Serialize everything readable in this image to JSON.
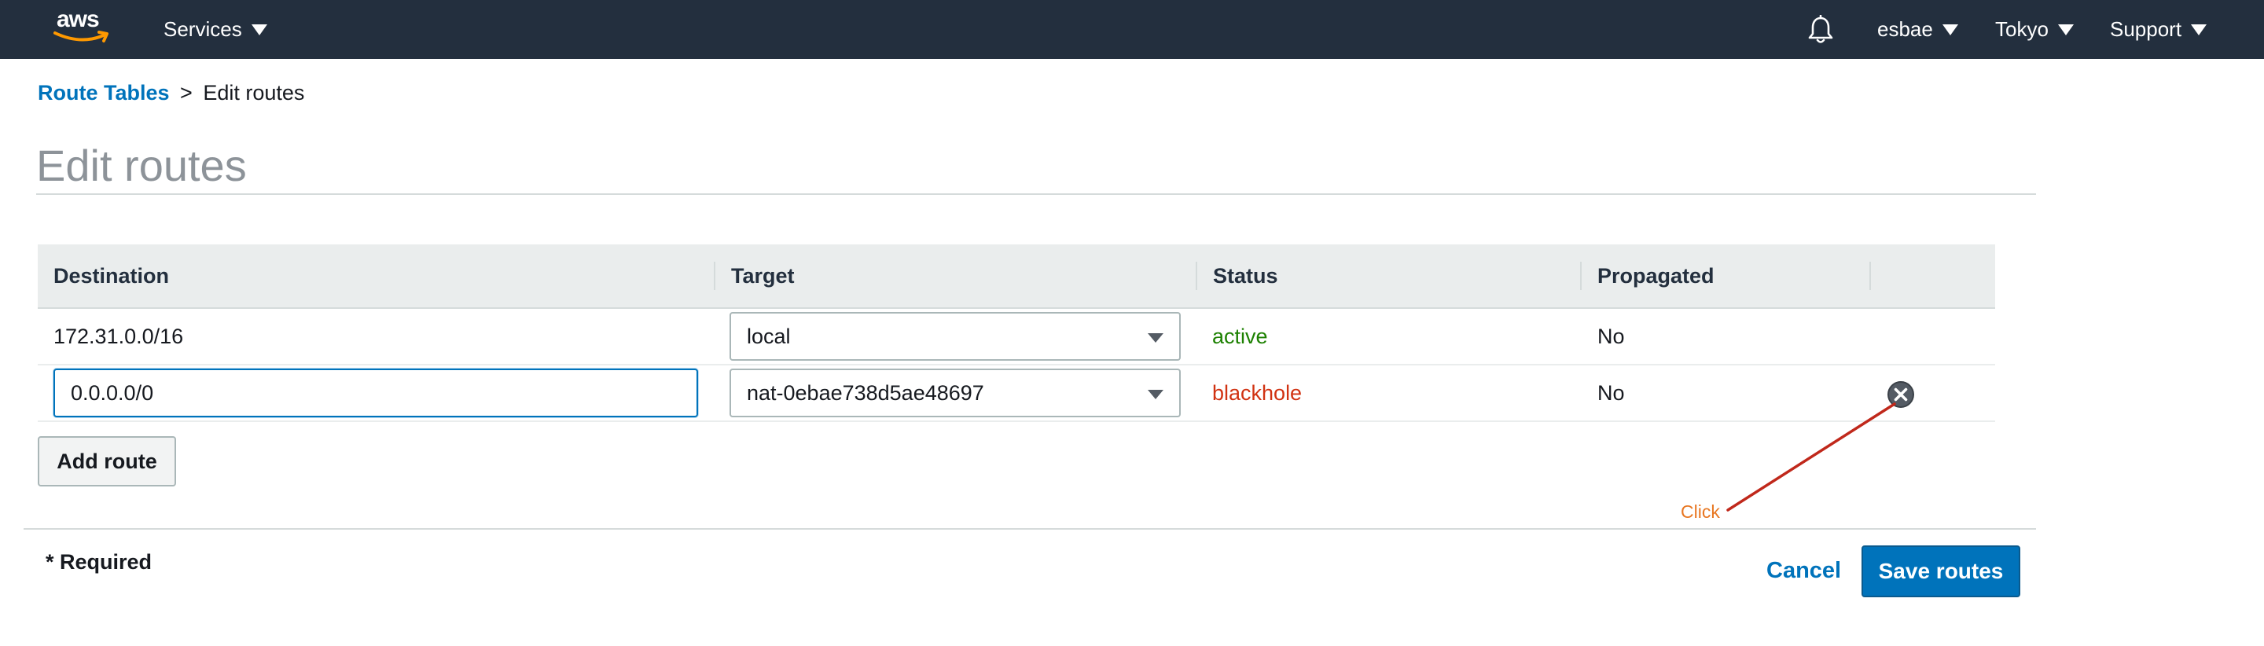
{
  "topnav": {
    "logo_text": "aws",
    "services_label": "Services",
    "bell_icon": "bell-icon",
    "user_label": "esbae",
    "region_label": "Tokyo",
    "support_label": "Support"
  },
  "breadcrumb": {
    "parent": "Route Tables",
    "separator": ">",
    "current": "Edit routes"
  },
  "page": {
    "title": "Edit routes"
  },
  "table": {
    "headers": {
      "destination": "Destination",
      "target": "Target",
      "status": "Status",
      "propagated": "Propagated"
    },
    "rows": [
      {
        "destination": "172.31.0.0/16",
        "target": "local",
        "status": "active",
        "propagated": "No"
      },
      {
        "destination": "0.0.0.0/0",
        "target": "nat-0ebae738d5ae48697",
        "status": "blackhole",
        "propagated": "No",
        "remove_icon": "remove-circle-x-icon"
      }
    ]
  },
  "actions": {
    "add_route": "Add route",
    "required_note": "* Required",
    "cancel": "Cancel",
    "save": "Save routes"
  },
  "annotation": {
    "label": "Click"
  },
  "colors": {
    "nav_bg": "#232f3e",
    "link": "#0073bb",
    "status_active": "#1d8102",
    "status_blackhole": "#d13212",
    "primary_button": "#0073bb",
    "annotation_line": "#c0281b",
    "annotation_text": "#e87722"
  }
}
